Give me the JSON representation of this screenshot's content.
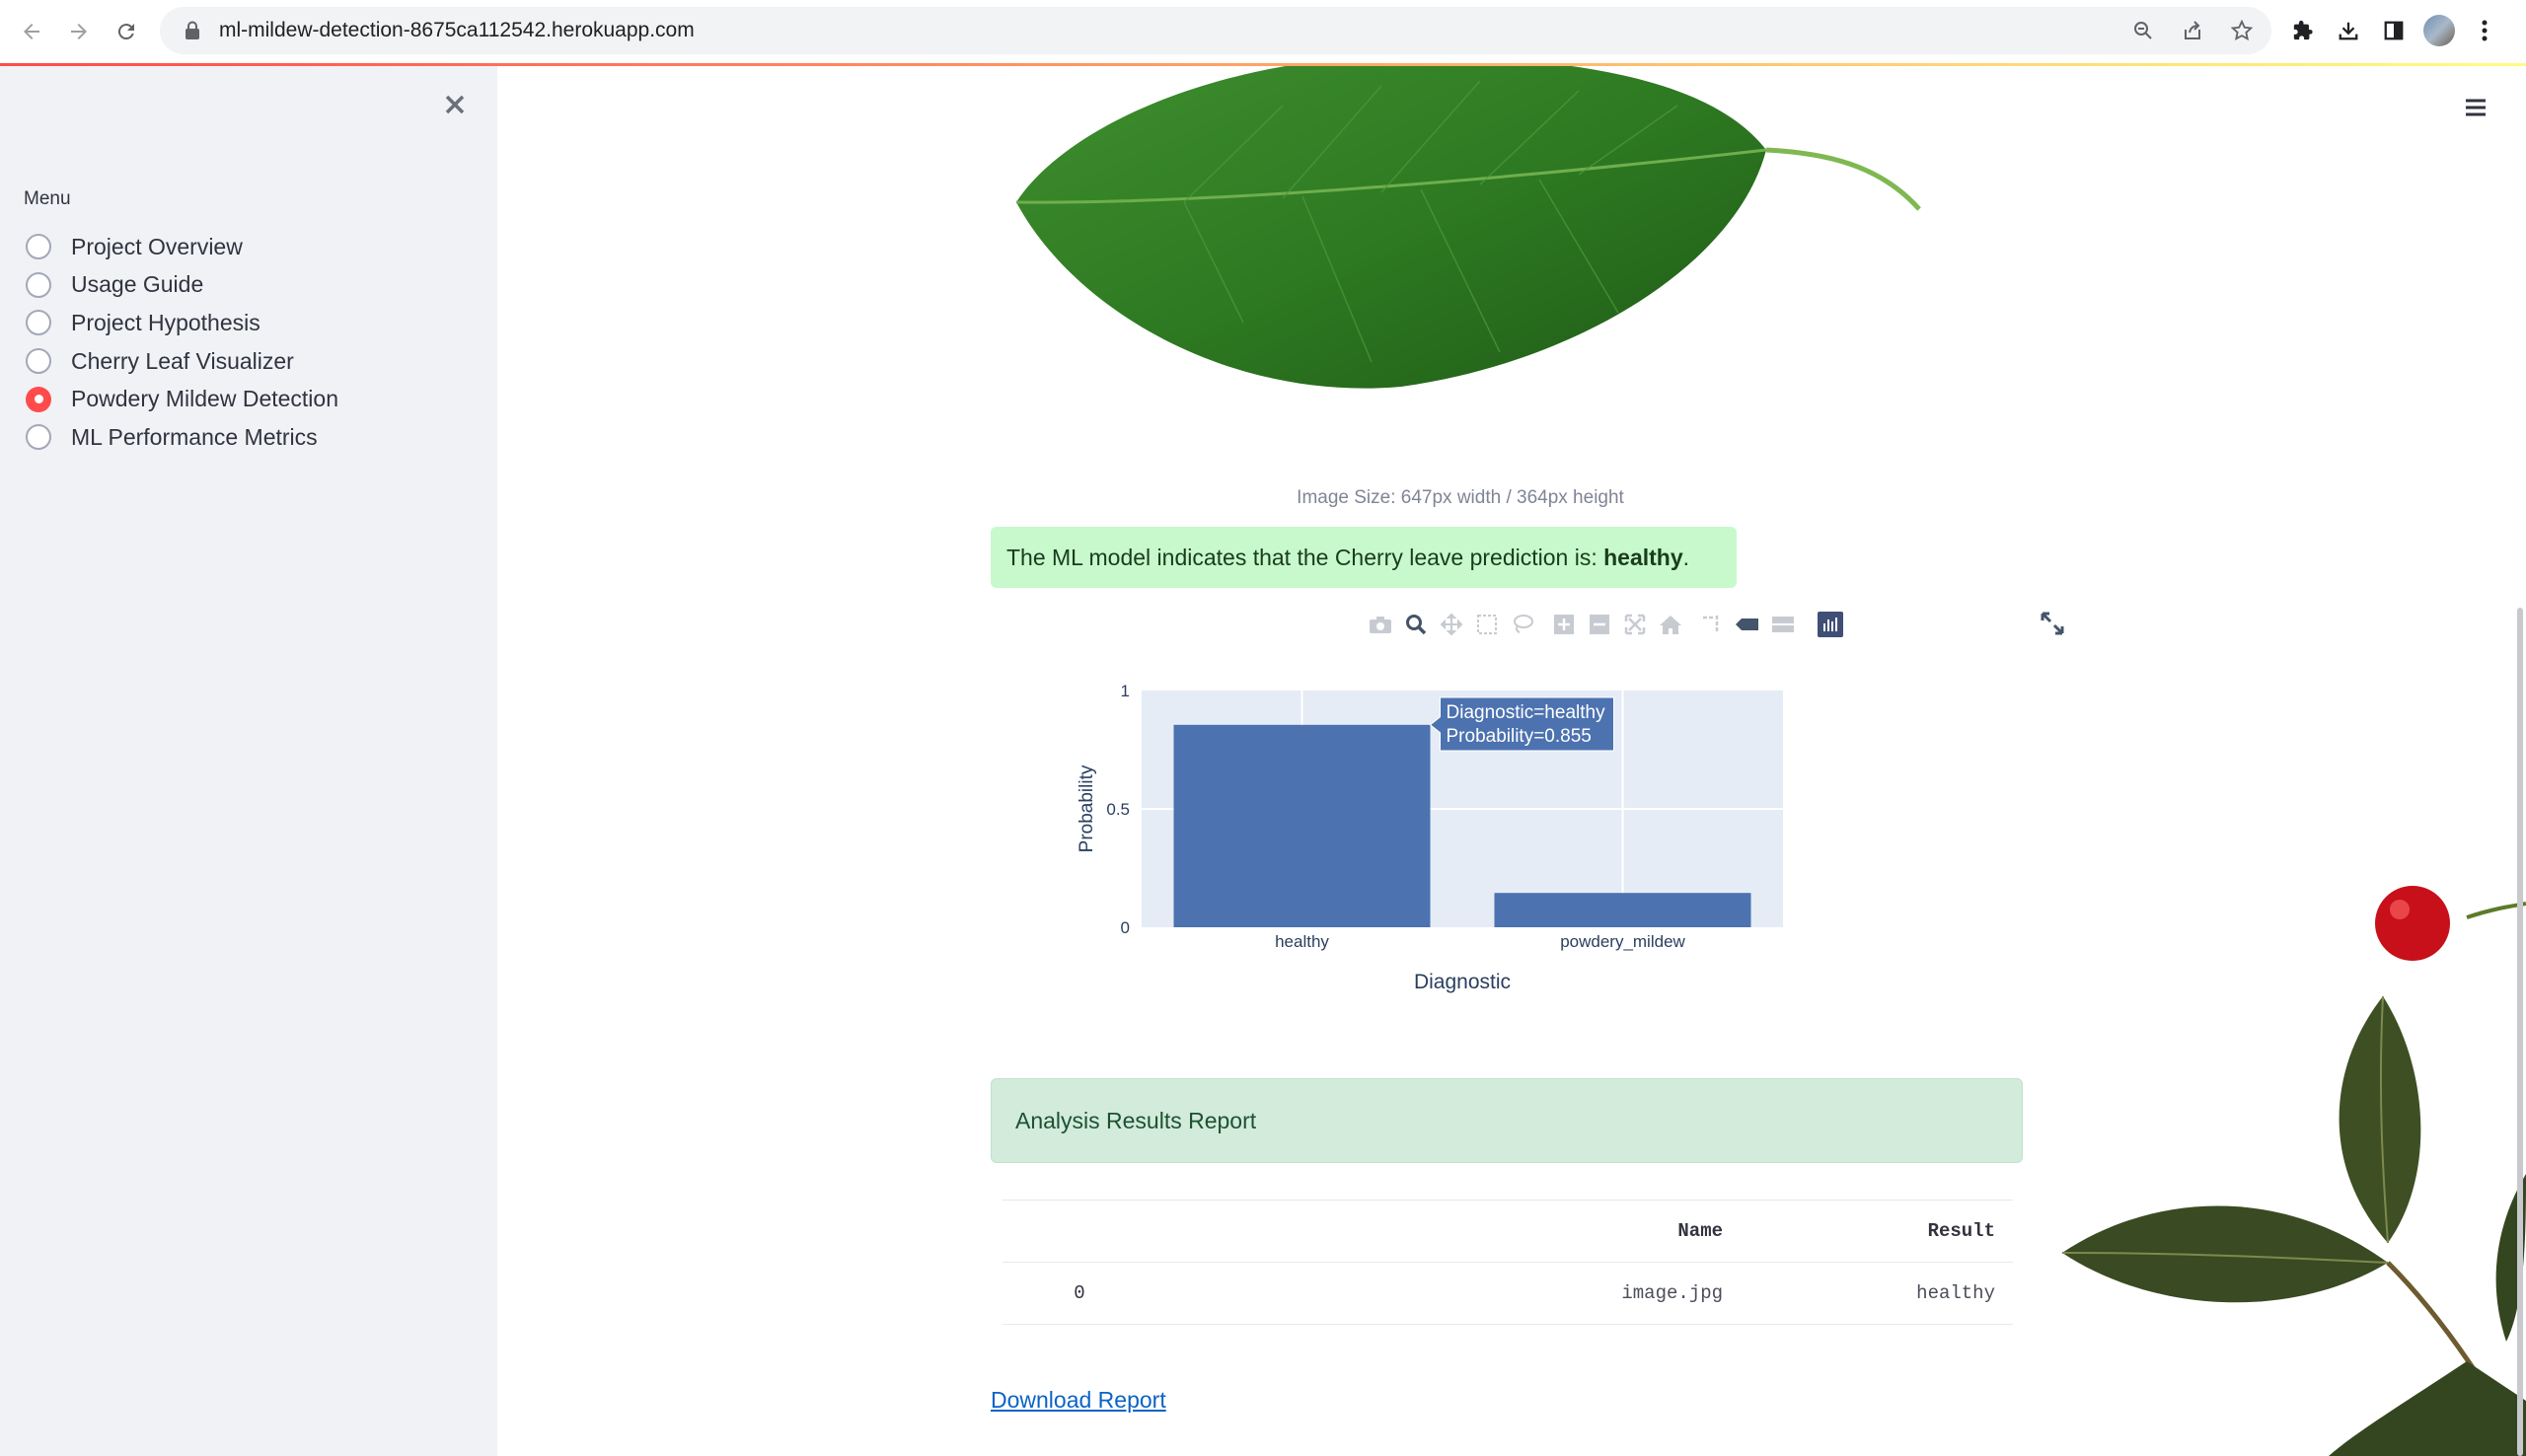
{
  "browser": {
    "url": "ml-mildew-detection-8675ca112542.herokuapp.com",
    "icons": [
      "back-icon",
      "forward-icon",
      "reload-icon",
      "lock-icon",
      "zoom-icon",
      "share-icon",
      "star-icon",
      "extensions-icon",
      "download-icon",
      "sidepanel-icon",
      "profile-avatar",
      "kebab-menu-icon"
    ]
  },
  "sidebar": {
    "menu_label": "Menu",
    "items": [
      {
        "label": "Project Overview",
        "selected": false
      },
      {
        "label": "Usage Guide",
        "selected": false
      },
      {
        "label": "Project Hypothesis",
        "selected": false
      },
      {
        "label": "Cherry Leaf Visualizer",
        "selected": false
      },
      {
        "label": "Powdery Mildew Detection",
        "selected": true
      },
      {
        "label": "ML Performance Metrics",
        "selected": false
      }
    ],
    "accent_color": "#ff4b4b"
  },
  "main": {
    "image_caption": "Image Size: 647px width / 364px height",
    "prediction_prefix": "The ML model indicates that the Cherry leave prediction is: ",
    "prediction_value": "healthy",
    "prediction_suffix": ".",
    "report_title": "Analysis Results Report",
    "table": {
      "headers": [
        "",
        "Name",
        "Result"
      ],
      "rows": [
        [
          "0",
          "image.jpg",
          "healthy"
        ]
      ]
    },
    "download_label": "Download Report"
  },
  "chart_data": {
    "type": "bar",
    "categories": [
      "healthy",
      "powdery_mildew"
    ],
    "values": [
      0.855,
      0.145
    ],
    "xlabel": "Diagnostic",
    "ylabel": "Probability",
    "ylim": [
      0,
      1
    ],
    "yticks": [
      "0",
      "0.5",
      "1"
    ],
    "bar_color": "#4c72b0",
    "grid": true,
    "tooltip": {
      "line1": "Diagnostic=healthy",
      "line2": "Probability=0.855"
    }
  }
}
